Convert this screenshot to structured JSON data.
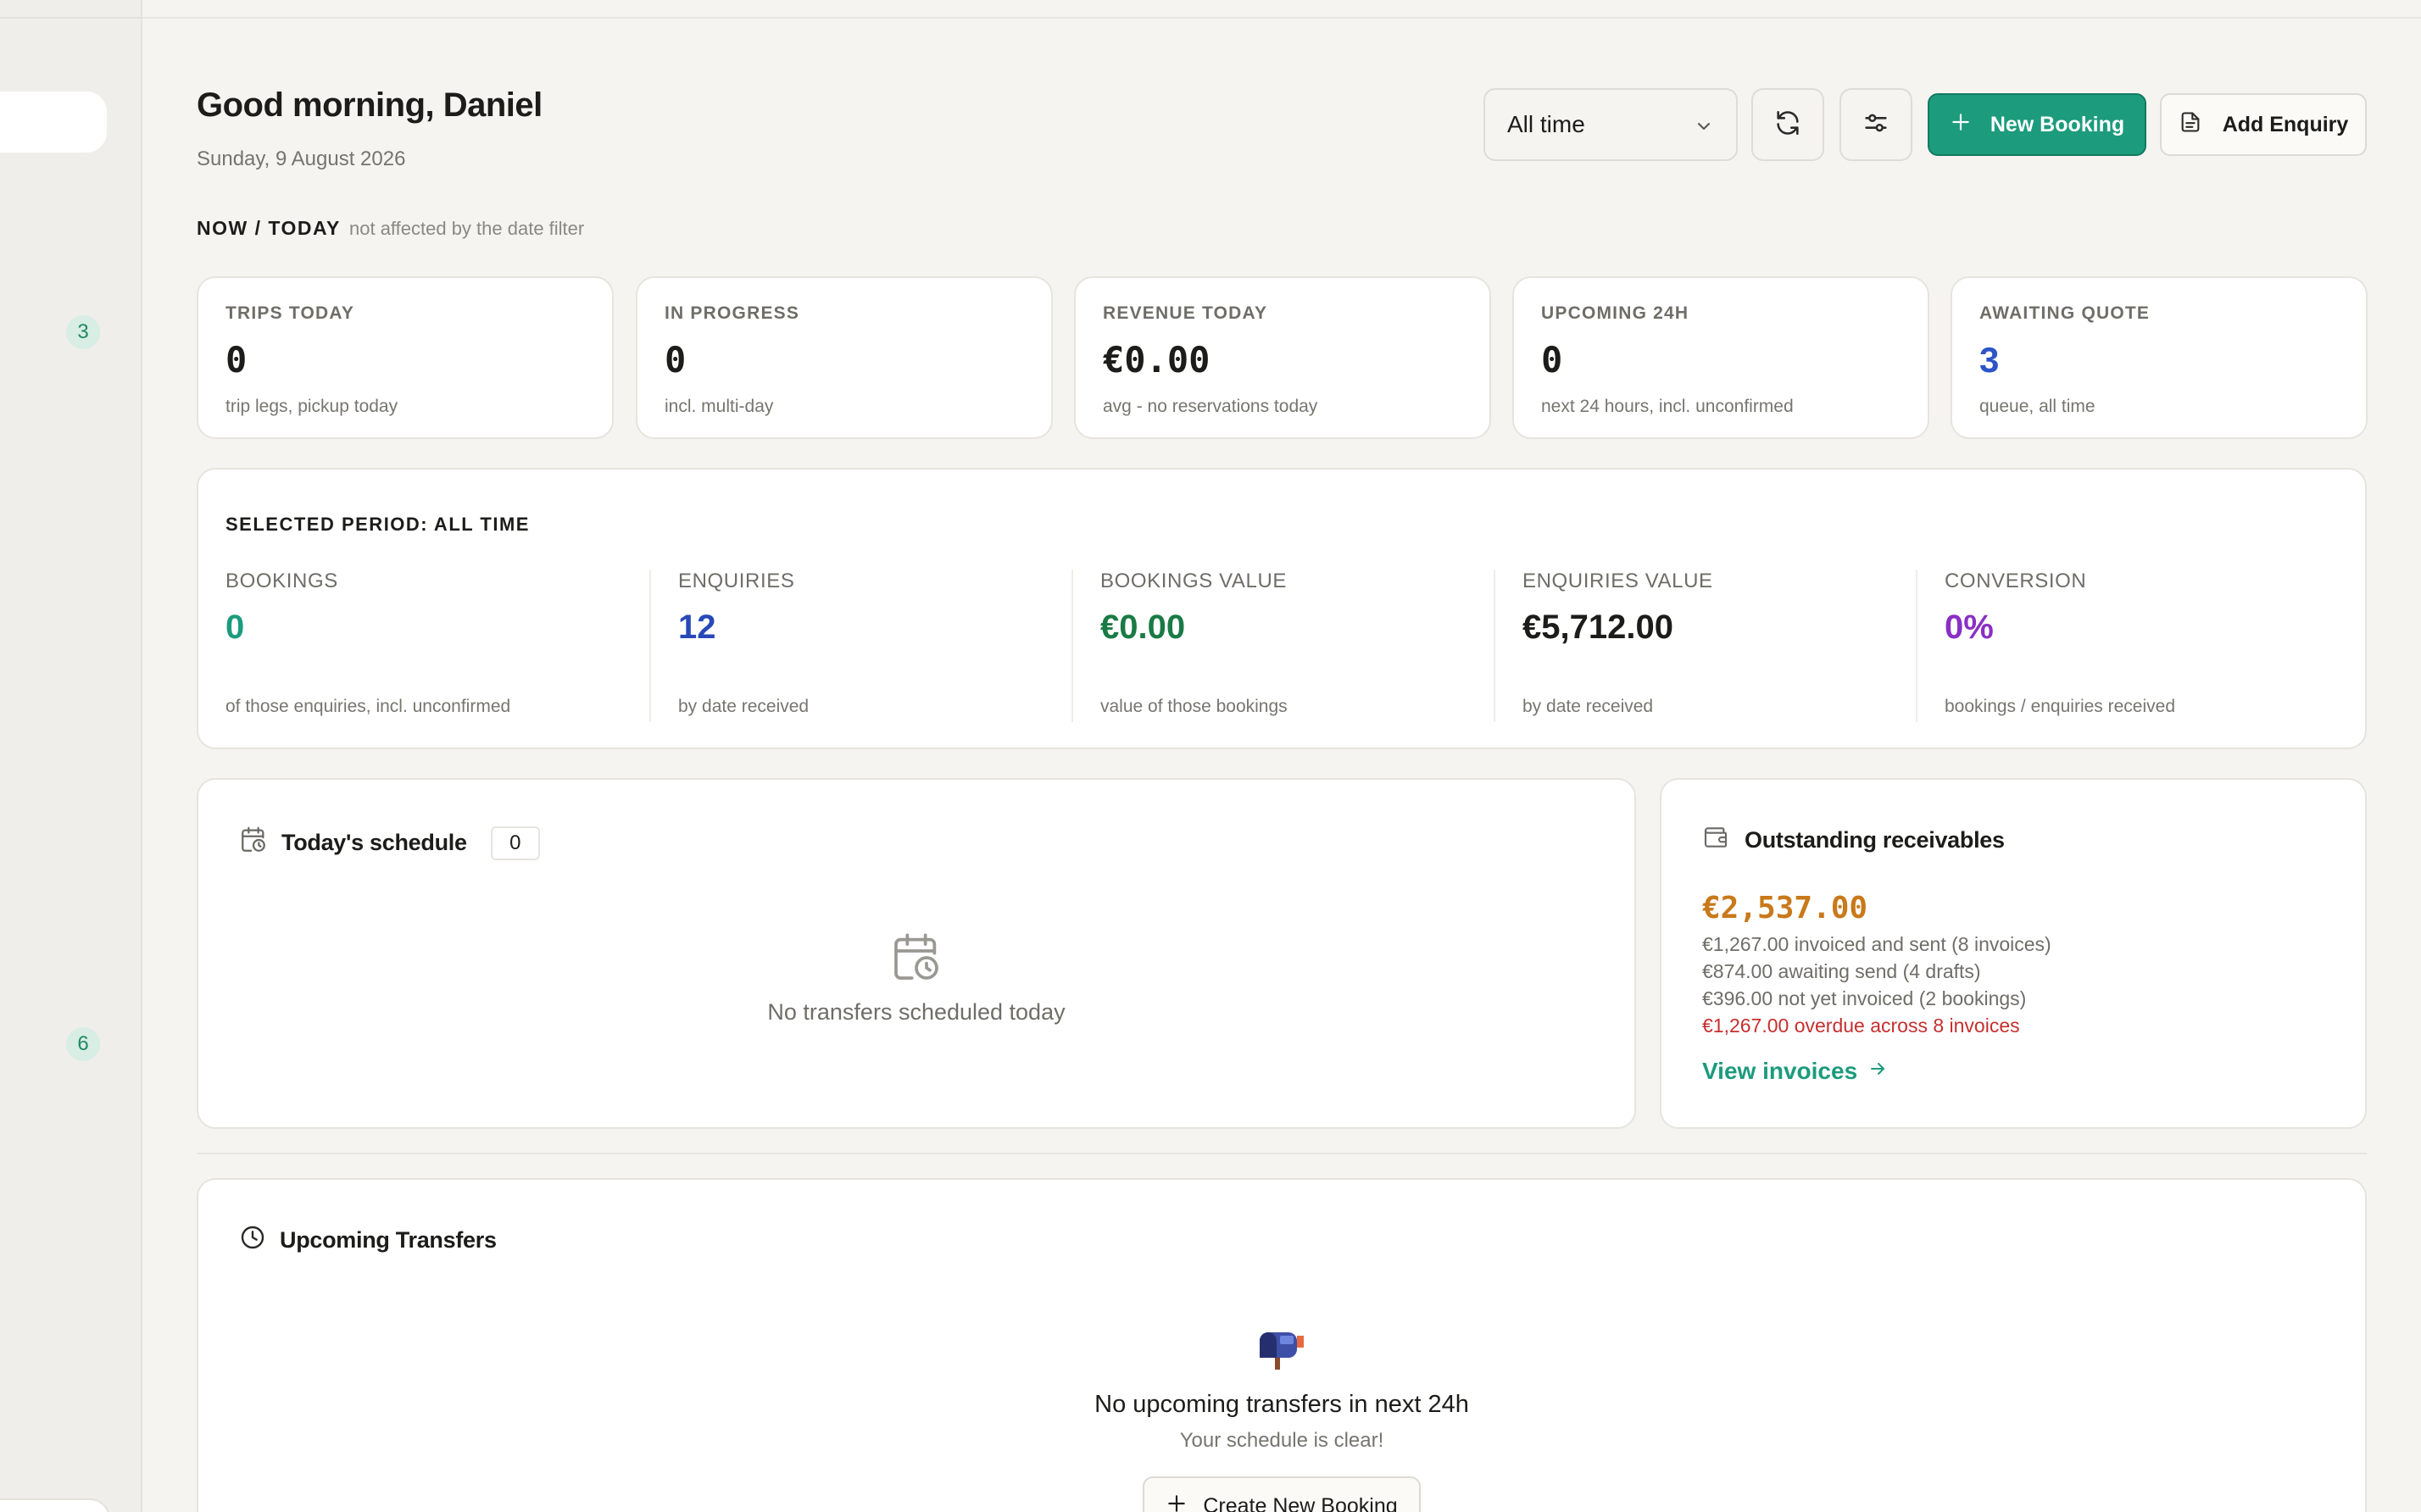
{
  "sidebar": {
    "badges": [
      "3",
      "6"
    ]
  },
  "header": {
    "greeting": "Good morning, Daniel",
    "date": "Sunday, 9 August 2026",
    "period_value": "All time",
    "new_booking_label": "New Booking",
    "add_enquiry_label": "Add Enquiry"
  },
  "now_today": {
    "label": "NOW / TODAY",
    "note": "not affected by the date filter",
    "cards": [
      {
        "label": "TRIPS TODAY",
        "value": "0",
        "sub": "trip legs, pickup today",
        "color": "#1c1c1a"
      },
      {
        "label": "IN PROGRESS",
        "value": "0",
        "sub": "incl. multi-day",
        "color": "#1c1c1a"
      },
      {
        "label": "REVENUE TODAY",
        "value": "€0.00",
        "sub": "avg - no reservations today",
        "color": "#1c1c1a"
      },
      {
        "label": "UPCOMING 24H",
        "value": "0",
        "sub": "next 24 hours, incl. unconfirmed",
        "color": "#1c1c1a"
      },
      {
        "label": "AWAITING QUOTE",
        "value": "3",
        "sub": "queue, all time",
        "color": "#2d55c9"
      }
    ]
  },
  "period": {
    "title": "SELECTED PERIOD: ALL TIME",
    "metrics": [
      {
        "label": "BOOKINGS",
        "value": "0",
        "sub": "of those enquiries, incl. unconfirmed",
        "color": "#1c9b7d"
      },
      {
        "label": "ENQUIRIES",
        "value": "12",
        "sub": "by date received",
        "color": "#2749b8"
      },
      {
        "label": "BOOKINGS VALUE",
        "value": "€0.00",
        "sub": "value of those bookings",
        "color": "#1a7a45"
      },
      {
        "label": "ENQUIRIES VALUE",
        "value": "€5,712.00",
        "sub": "by date received",
        "color": "#1c1c1a"
      },
      {
        "label": "CONVERSION",
        "value": "0%",
        "sub": "bookings / enquiries received",
        "color": "#8a2fc4"
      }
    ]
  },
  "schedule": {
    "title": "Today's schedule",
    "count": "0",
    "empty": "No transfers scheduled today"
  },
  "receivables": {
    "title": "Outstanding receivables",
    "total": "€2,537.00",
    "lines": [
      "€1,267.00 invoiced and sent (8 invoices)",
      "€874.00 awaiting send (4 drafts)",
      "€396.00 not yet invoiced (2 bookings)"
    ],
    "overdue": "€1,267.00 overdue across 8 invoices",
    "link": "View invoices"
  },
  "upcoming": {
    "title": "Upcoming Transfers",
    "empty_title": "No upcoming transfers in next 24h",
    "empty_sub": "Your schedule is clear!",
    "create_label": "Create New Booking"
  }
}
